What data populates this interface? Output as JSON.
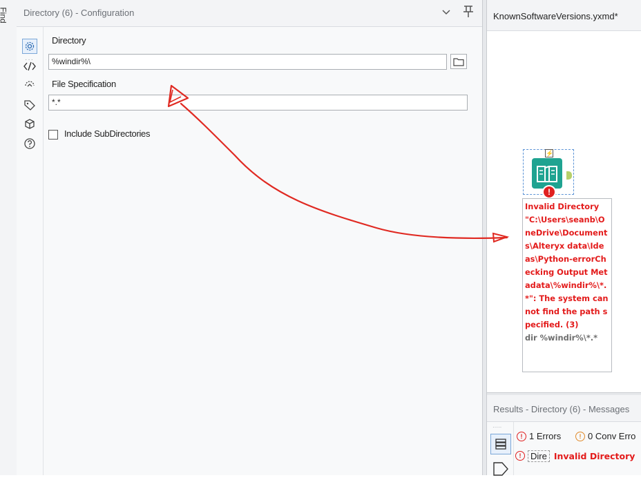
{
  "sidebar": {
    "find_label": "Find"
  },
  "config": {
    "title": "Directory (6) - Configuration",
    "directory_label": "Directory",
    "directory_value": "%windir%\\",
    "file_spec_label": "File Specification",
    "file_spec_value": "*.*",
    "include_subdirs_label": "Include SubDirectories",
    "include_subdirs_checked": false,
    "rail_icons": [
      "gear-icon",
      "code-icon",
      "connection-icon",
      "tag-icon",
      "cube-icon",
      "help-icon"
    ]
  },
  "canvas": {
    "tab_title": "KnownSoftwareVersions.yxmd*",
    "tool_badge": "⚡",
    "error_badge": "!",
    "error_message": "Invalid Directory \"C:\\Users\\seanb\\OneDrive\\Documents\\Alteryx data\\Ideas\\Python-errorChecking Output Metadata\\%windir%\\*.*\": The system cannot find the path specified. (3)",
    "annotation": "dir %windir%\\*.*"
  },
  "results": {
    "title": "Results - Directory (6) - Messages",
    "errors_filter": "1 Errors",
    "conv_errors_filter": "0 Conv Erro",
    "row_tool": "Dire",
    "row_message": "Invalid Directory",
    "error_color": "#e02020"
  }
}
